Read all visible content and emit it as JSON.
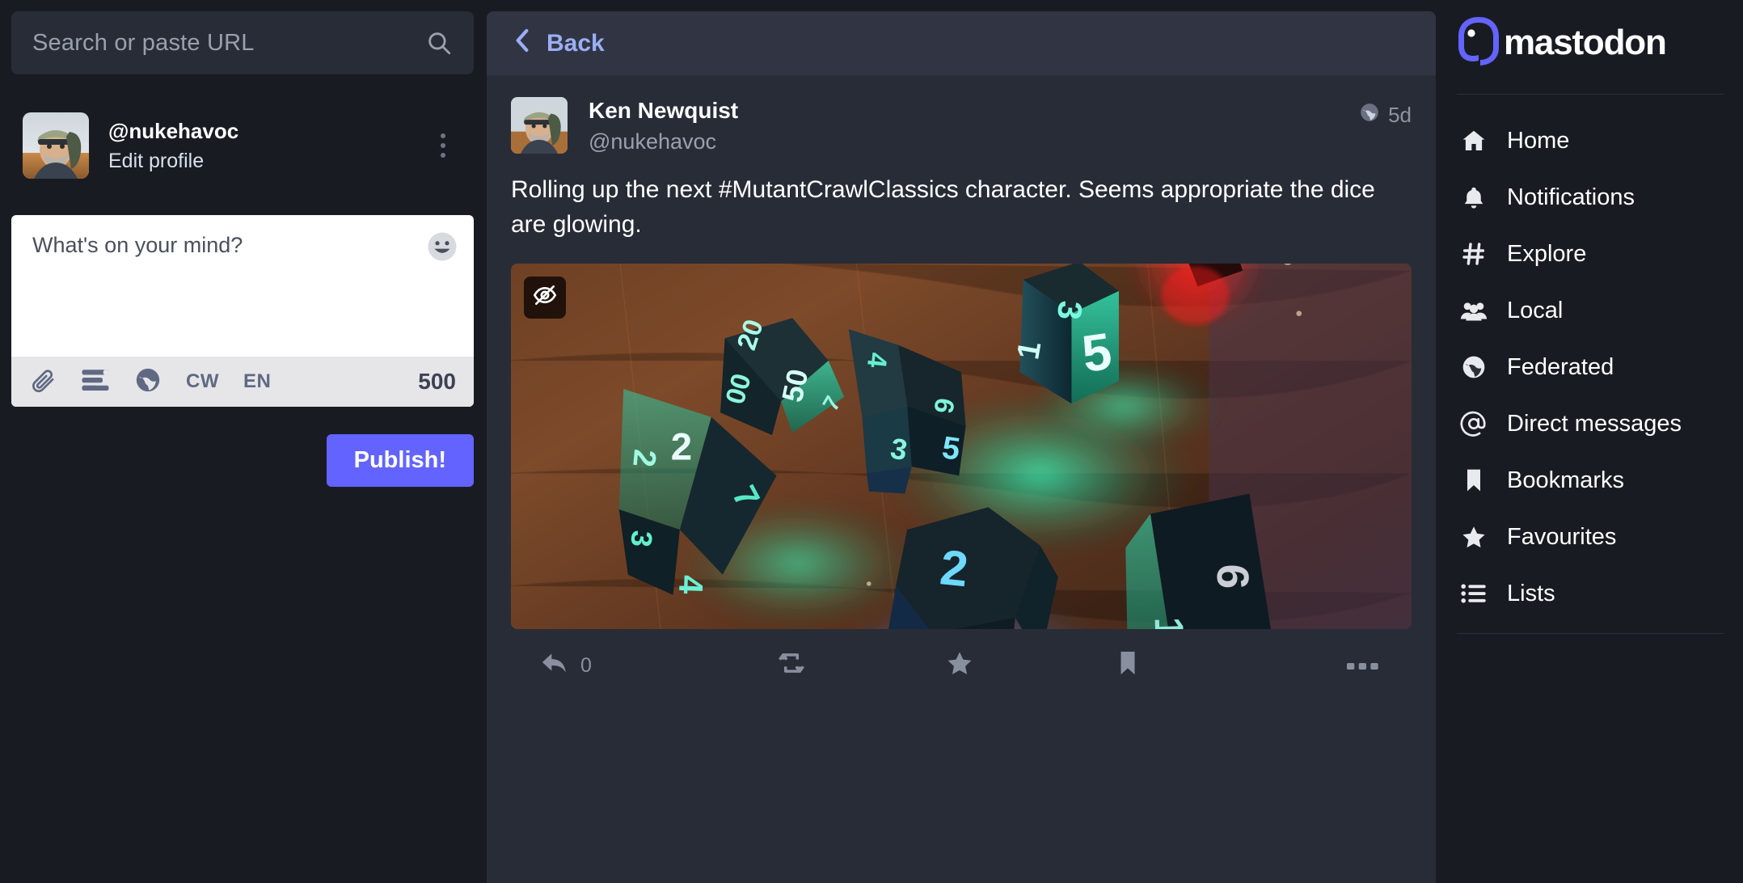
{
  "search": {
    "placeholder": "Search or paste URL",
    "icon": "search-icon"
  },
  "profile": {
    "handle": "@nukehavoc",
    "edit_label": "Edit profile",
    "menu_icon": "kebab-menu-icon"
  },
  "composer": {
    "placeholder": "What's on your mind?",
    "value": "",
    "emoji_icon": "emoji-smile-icon",
    "attach_icon": "paperclip-icon",
    "poll_icon": "poll-icon",
    "visibility_icon": "globe-icon",
    "cw_label": "CW",
    "language_label": "EN",
    "char_count": "500",
    "publish_label": "Publish!"
  },
  "center": {
    "back_label": "Back",
    "back_icon": "chevron-left-icon"
  },
  "status": {
    "display_name": "Ken Newquist",
    "acct": "@nukehavoc",
    "visibility_icon": "globe-icon",
    "timestamp": "5d",
    "content": "Rolling up the next #MutantCrawlClassics  character. Seems appropriate the dice are glowing.",
    "media": {
      "hide_icon": "eye-off-icon",
      "alt": "Glowing polyhedral dice on a wooden table"
    },
    "actions": {
      "reply_icon": "reply-icon",
      "reply_count": "0",
      "boost_icon": "boost-icon",
      "favourite_icon": "star-icon",
      "bookmark_icon": "bookmark-icon",
      "more_icon": "ellipsis-icon"
    }
  },
  "sidebar": {
    "brand": "mastodon",
    "brand_icon": "mastodon-logo-icon",
    "items": [
      {
        "label": "Home",
        "icon": "home-icon"
      },
      {
        "label": "Notifications",
        "icon": "bell-icon"
      },
      {
        "label": "Explore",
        "icon": "hashtag-icon"
      },
      {
        "label": "Local",
        "icon": "people-icon"
      },
      {
        "label": "Federated",
        "icon": "globe-icon"
      },
      {
        "label": "Direct messages",
        "icon": "at-icon"
      },
      {
        "label": "Bookmarks",
        "icon": "bookmark-icon"
      },
      {
        "label": "Favourites",
        "icon": "star-icon"
      },
      {
        "label": "Lists",
        "icon": "list-icon"
      }
    ]
  },
  "colors": {
    "accent": "#6364ff",
    "link": "#9baef6",
    "bg": "#191b22",
    "panel": "#313543",
    "status_bg": "#282c37"
  }
}
